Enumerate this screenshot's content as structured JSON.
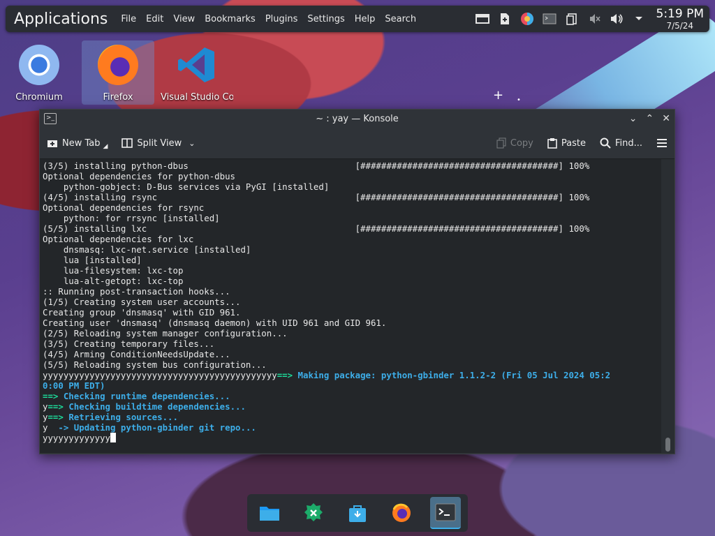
{
  "panel": {
    "apps_label": "Applications",
    "menu": [
      "File",
      "Edit",
      "View",
      "Bookmarks",
      "Plugins",
      "Settings",
      "Help",
      "Search"
    ],
    "clock_time": "5:19 PM",
    "clock_date": "7/5/24"
  },
  "desktop": {
    "icons": [
      {
        "label": "Chromium"
      },
      {
        "label": "Firefox"
      },
      {
        "label": "Visual Studio Code"
      }
    ]
  },
  "window": {
    "title": "~ : yay — Konsole",
    "toolbar": {
      "new_tab": "New Tab",
      "split_view": "Split View",
      "copy": "Copy",
      "paste": "Paste",
      "find": "Find..."
    }
  },
  "terminal": {
    "lines": [
      "(3/5) installing python-dbus                                [######################################] 100%",
      "Optional dependencies for python-dbus",
      "    python-gobject: D-Bus services via PyGI [installed]",
      "(4/5) installing rsync                                      [######################################] 100%",
      "Optional dependencies for rsync",
      "    python: for rrsync [installed]",
      "(5/5) installing lxc                                        [######################################] 100%",
      "Optional dependencies for lxc",
      "    dnsmasq: lxc-net.service [installed]",
      "    lua [installed]",
      "    lua-filesystem: lxc-top",
      "    lua-alt-getopt: lxc-top",
      ":: Running post-transaction hooks...",
      "(1/5) Creating system user accounts...",
      "Creating group 'dnsmasq' with GID 961.",
      "Creating user 'dnsmasq' (dnsmasq daemon) with UID 961 and GID 961.",
      "(2/5) Reloading system manager configuration...",
      "(3/5) Creating temporary files...",
      "(4/5) Arming ConditionNeedsUpdate...",
      "(5/5) Reloading system bus configuration..."
    ],
    "making_prefix": "yyyyyyyyyyyyyyyyyyyyyyyyyyyyyyyyyyyyyyyyyyyyy",
    "making_arrow": "==>",
    "making_text": " Making package: python-gbinder 1.1.2-2 (Fri 05 Jul 2024 05:2",
    "making_text_cont": "0:00 PM EDT)",
    "check_runtime_arrow": "==>",
    "check_runtime": " Checking runtime dependencies...",
    "check_build_prefix": "y",
    "check_build_arrow": "==>",
    "check_build": " Checking buildtime dependencies...",
    "retrieve_prefix": "y",
    "retrieve_arrow": "==>",
    "retrieve": " Retrieving sources...",
    "update_prefix": "y  ",
    "update_arrow": "->",
    "update": " Updating python-gbinder git repo...",
    "input": "yyyyyyyyyyyyy"
  },
  "taskbar": {
    "items": [
      "dolphin-icon",
      "discover-icon",
      "store-icon",
      "firefox-icon",
      "konsole-icon"
    ]
  },
  "colors": {
    "accent": "#3daee9",
    "green": "#1cdc9a",
    "terminal_bg": "#232629"
  }
}
